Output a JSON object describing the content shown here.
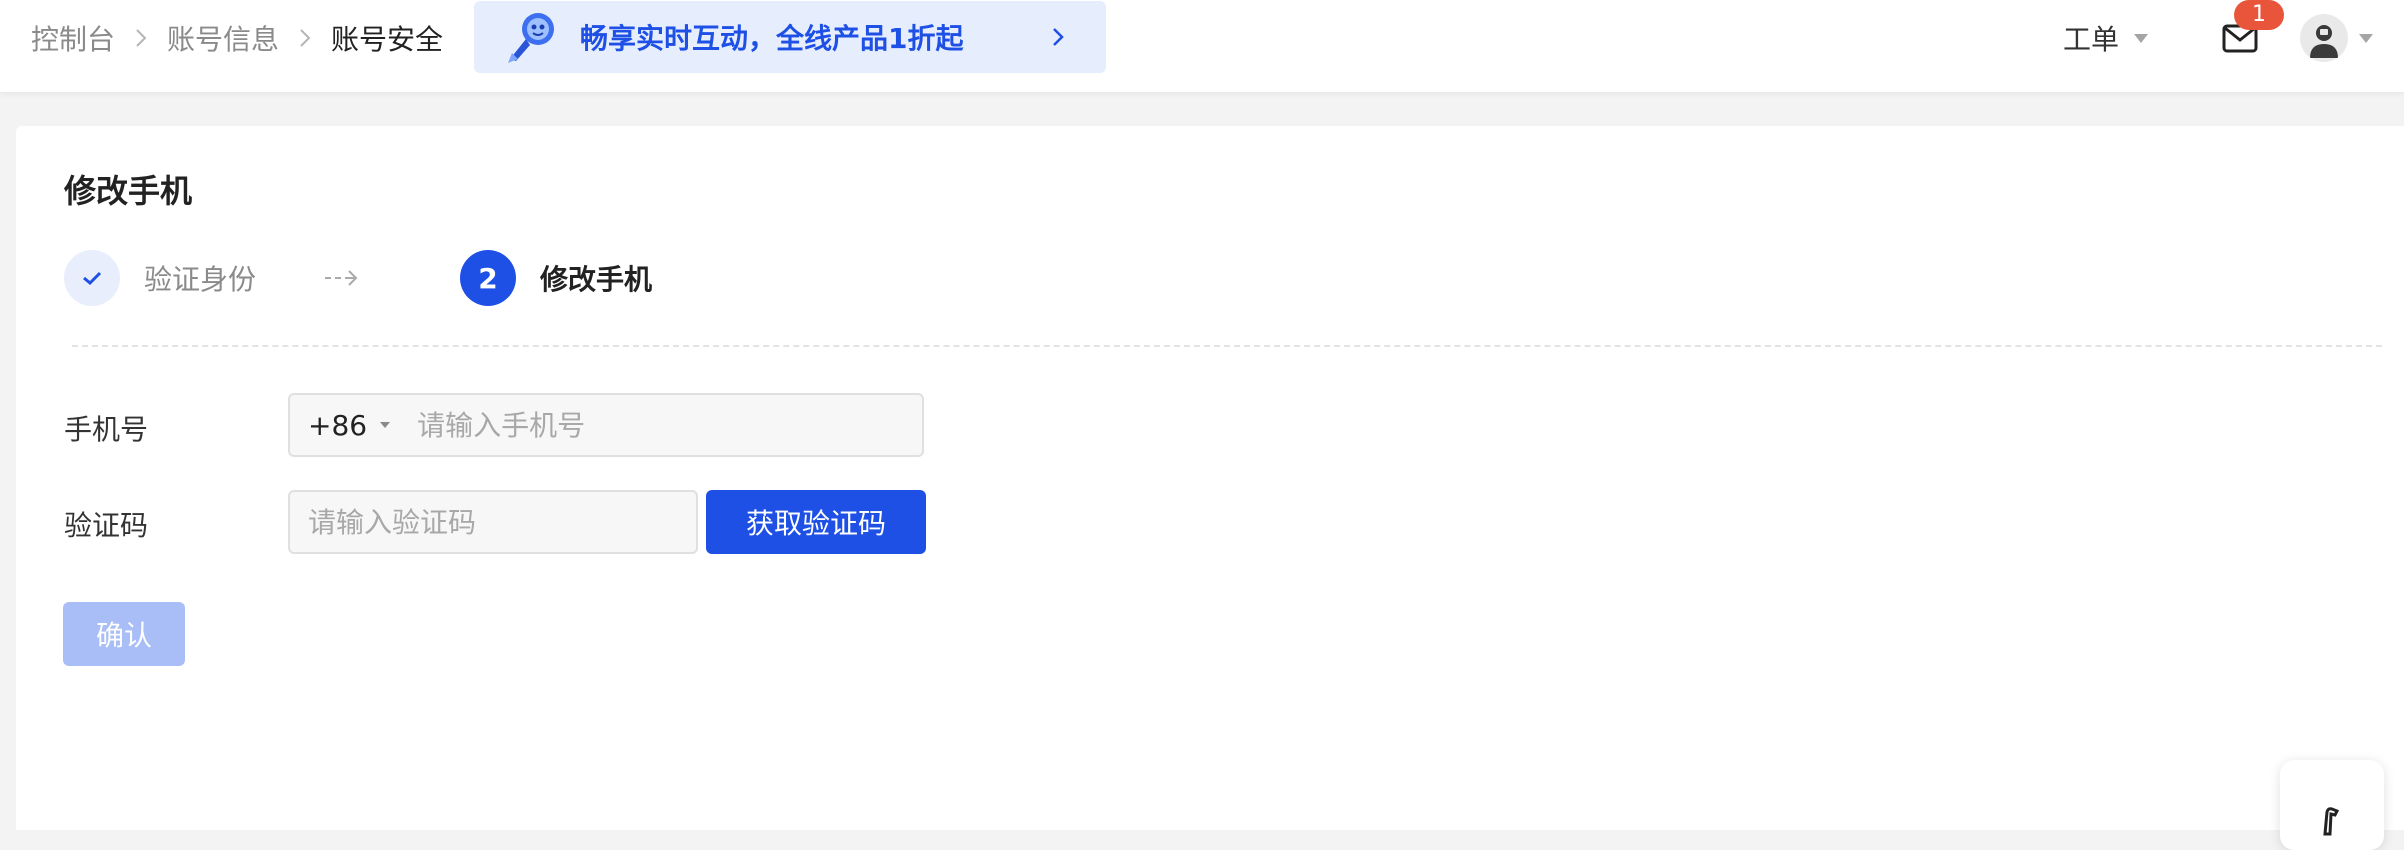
{
  "breadcrumb": {
    "items": [
      "控制台",
      "账号信息",
      "账号安全"
    ]
  },
  "promo": {
    "text": "畅享实时互动，全线产品1折起"
  },
  "header": {
    "ticket_label": "工单",
    "mail_badge": "1"
  },
  "page": {
    "title": "修改手机"
  },
  "steps": [
    {
      "label": "验证身份",
      "status": "done"
    },
    {
      "number": "2",
      "label": "修改手机",
      "status": "active"
    }
  ],
  "form": {
    "phone_label": "手机号",
    "country_code": "+86",
    "phone_placeholder": "请输入手机号",
    "code_label": "验证码",
    "code_placeholder": "请输入验证码",
    "get_code_label": "获取验证码",
    "confirm_label": "确认"
  },
  "colors": {
    "primary": "#1e50e6",
    "primary_disabled": "#a9bdf6",
    "promo_bg": "#e6eefe",
    "badge": "#e8553b"
  },
  "icons": [
    "chevron-right-icon",
    "rocket-icon",
    "caret-down-icon",
    "mail-icon",
    "user-avatar-icon",
    "check-icon",
    "dashed-arrow-icon"
  ]
}
